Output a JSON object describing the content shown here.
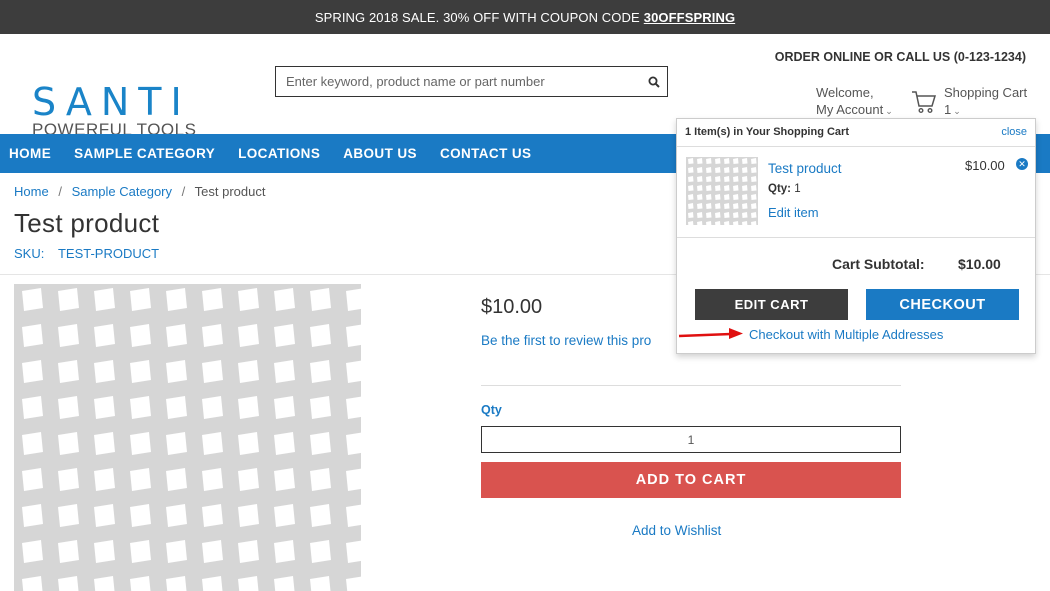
{
  "promo": {
    "text": "SPRING 2018 SALE. 30% OFF WITH COUPON CODE",
    "code": "30OFFSPRING"
  },
  "header": {
    "logo_top": "SANTI",
    "logo_bottom": "POWERFUL TOOLS",
    "order_line": "ORDER ONLINE OR CALL US (0-123-1234)",
    "welcome": "Welcome,",
    "my_account": "My Account",
    "cart_label": "Shopping Cart",
    "cart_count": "1"
  },
  "search": {
    "placeholder": "Enter keyword, product name or part number"
  },
  "nav": {
    "items": [
      "HOME",
      "SAMPLE CATEGORY",
      "LOCATIONS",
      "ABOUT US",
      "CONTACT US"
    ]
  },
  "breadcrumb": {
    "home": "Home",
    "category": "Sample Category",
    "current": "Test product",
    "separator": "/"
  },
  "product": {
    "title": "Test product",
    "sku_label": "SKU:",
    "sku_value": "TEST-PRODUCT",
    "price": "$10.00",
    "review_link": "Be the first to review this pro",
    "qty_label": "Qty",
    "qty_value": "1",
    "add_to_cart": "ADD TO CART",
    "wishlist": "Add to Wishlist"
  },
  "minicart": {
    "heading": "1 Item(s) in Your Shopping Cart",
    "close": "close",
    "item_name": "Test product",
    "item_qty_label": "Qty:",
    "item_qty": "1",
    "edit_item": "Edit item",
    "item_price": "$10.00",
    "subtotal_label": "Cart Subtotal:",
    "subtotal_value": "$10.00",
    "edit_cart": "EDIT CART",
    "checkout": "CHECKOUT",
    "multi_address": "Checkout with Multiple Addresses"
  },
  "colors": {
    "brand_blue": "#1a7ac4",
    "promo_bg": "#3d3d3d",
    "add_to_cart": "#d9534f",
    "arrow": "#e01010"
  }
}
